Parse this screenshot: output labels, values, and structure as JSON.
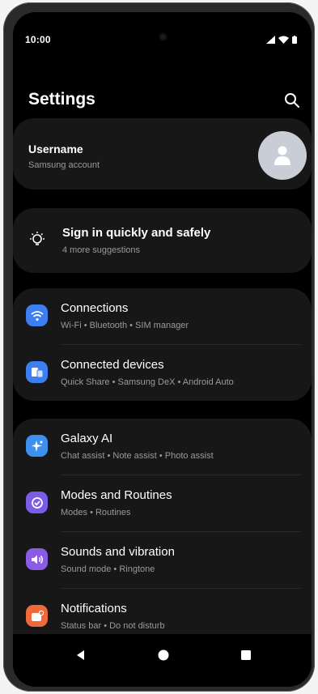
{
  "status": {
    "time": "10:00",
    "icons": [
      "signal-icon",
      "wifi-icon",
      "battery-icon"
    ]
  },
  "header": {
    "title": "Settings",
    "search_icon": "search-icon"
  },
  "account": {
    "name": "Username",
    "subtitle": "Samsung account",
    "avatar_icon": "person-icon"
  },
  "suggestion": {
    "title": "Sign in quickly and safely",
    "subtitle": "4 more suggestions",
    "icon": "lightbulb-icon"
  },
  "groups": [
    {
      "items": [
        {
          "title": "Connections",
          "subtitle": "Wi-Fi  •  Bluetooth  •  SIM manager",
          "icon": "wifi-icon",
          "color": "#3d7ef0"
        },
        {
          "title": "Connected devices",
          "subtitle": "Quick Share  •  Samsung DeX  •  Android Auto",
          "icon": "devices-icon",
          "color": "#3d7ef0"
        }
      ]
    },
    {
      "items": [
        {
          "title": "Galaxy AI",
          "subtitle": "Chat assist  •  Note assist  •  Photo assist",
          "icon": "sparkle-icon",
          "color": "#3d8ff0"
        },
        {
          "title": "Modes and Routines",
          "subtitle": "Modes  •  Routines",
          "icon": "routines-icon",
          "color": "#7a5ce6"
        },
        {
          "title": "Sounds and vibration",
          "subtitle": "Sound mode  •  Ringtone",
          "icon": "volume-icon",
          "color": "#8a5ce6"
        },
        {
          "title": "Notifications",
          "subtitle": "Status bar  •  Do not disturb",
          "icon": "notification-icon",
          "color": "#ef6a3a"
        }
      ]
    }
  ],
  "navbar": {
    "back_icon": "back-icon",
    "home_icon": "home-icon",
    "recents_icon": "recents-icon"
  }
}
